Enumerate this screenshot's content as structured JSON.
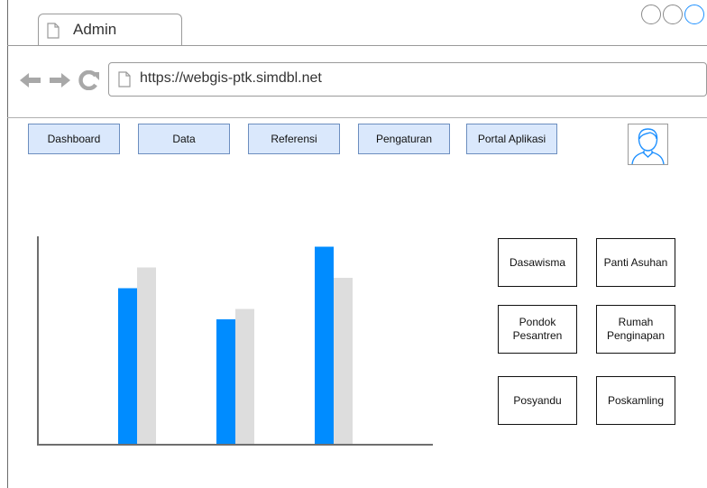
{
  "browser": {
    "tab_title": "Admin",
    "url": "https://webgis-ptk.simdbl.net",
    "icons": [
      "page-icon",
      "back-arrow-icon",
      "forward-arrow-icon",
      "reload-icon"
    ]
  },
  "menu": {
    "items": [
      {
        "label": "Dashboard"
      },
      {
        "label": "Data"
      },
      {
        "label": "Referensi"
      },
      {
        "label": "Pengaturan"
      },
      {
        "label": "Portal Aplikasi"
      }
    ],
    "avatar_icon": "user-avatar-icon"
  },
  "categories": {
    "tiles": [
      {
        "label": "Dasawisma"
      },
      {
        "label": "Panti Asuhan"
      },
      {
        "label": "Pondok Pesantren"
      },
      {
        "label": "Rumah Penginapan"
      },
      {
        "label": "Posyandu"
      },
      {
        "label": "Poskamling"
      }
    ]
  },
  "chart_data": {
    "type": "bar",
    "title": "",
    "xlabel": "",
    "ylabel": "",
    "categories": [
      "",
      "",
      ""
    ],
    "series": [
      {
        "values": [
          75,
          60,
          95
        ],
        "color": "#008cff"
      },
      {
        "values": [
          85,
          65,
          80
        ],
        "color": "#dddddd"
      }
    ],
    "ylim": [
      0,
      100
    ],
    "grid": false
  },
  "colors": {
    "menu_fill": "#dae8fc",
    "menu_border": "#6c8ebf",
    "accent": "#008cff"
  }
}
